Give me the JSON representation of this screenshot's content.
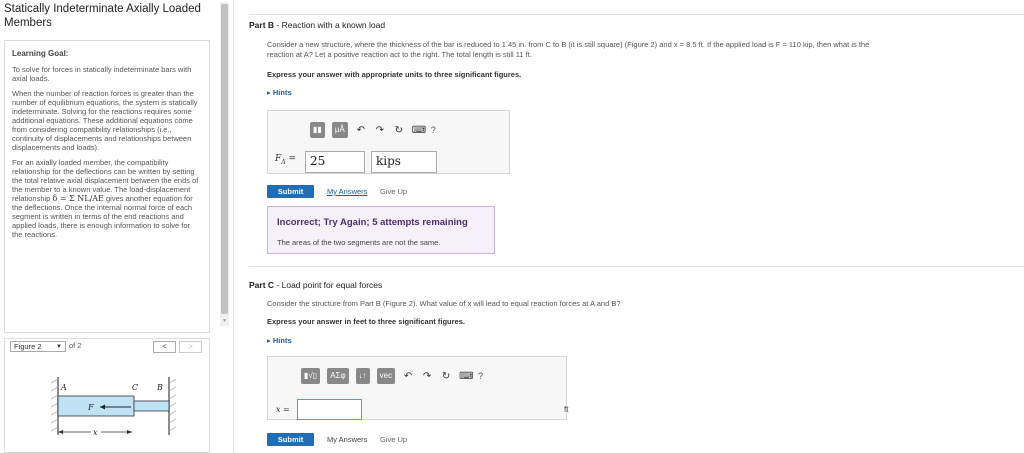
{
  "problem": {
    "title_line1": "Statically Indeterminate Axially Loaded",
    "title_line2": "Members"
  },
  "learning_goal": {
    "heading": "Learning Goal:",
    "p1": "To solve for forces in statically indeterminate bars with axial loads.",
    "p2": "When the number of reaction forces is greater than the number of equilibrium equations, the system is statically indeterminate. Solving for the reactions requires some additional equations. These additional equations come from considering compatibility relationships (i.e., continuity of displacements and relationships between displacements and loads).",
    "p3a": "For an axially loaded member, the compatibility relationship for the deflections can be written by setting the total relative axial displacement between the ends of the member to a known value. The load-displacement relationship",
    "formula": "δ = Σ NL/AE",
    "p3b": "gives another equation for the deflections. Once the internal normal force of each segment is written in terms of the end reactions and applied loads, there is enough information to solve for the reactions."
  },
  "figure": {
    "select_label": "Figure 2",
    "of_label": "of 2",
    "prev": "<",
    "next": ">",
    "labels": {
      "a": "A",
      "c": "C",
      "b": "B",
      "f": "F",
      "x": "x"
    }
  },
  "part_b": {
    "label": "Part B",
    "title": "Reaction with a known load",
    "body_line1": "Consider a new structure, where the thickness of the bar is reduced to 1.45 in. from C to B (it is still square) (Figure 2) and x = 8.5 ft. If the applied load is F = 110 kip, then what is the",
    "body_line2": "reaction at A? Let a positive reaction act to the right. The total length is still 11 ft.",
    "instruction": "Express your answer with appropriate units to three significant figures.",
    "hints": "Hints",
    "toolbar_btn2": "μÅ",
    "answer_label": "F",
    "answer_sub": "A",
    "equals": "=",
    "answer_value": "25",
    "answer_unit": "kips",
    "submit": "Submit",
    "my_answers": "My Answers",
    "give_up": "Give Up",
    "feedback_head": "Incorrect; Try Again; 5 attempts remaining",
    "feedback_msg": "The areas of the two segments are not the same."
  },
  "part_c": {
    "label": "Part C",
    "title": "Load point for equal forces",
    "body": "Consider the structure from Part B (Figure 2). What value of x will lead to equal reaction forces at A and B?",
    "instruction": "Express your answer in feet to three significant figures.",
    "hints": "Hints",
    "toolbar_btn2": "ΑΣφ",
    "toolbar_btn3": "vec",
    "answer_label": "x =",
    "answer_value": "",
    "answer_unit": "ft",
    "submit": "Submit",
    "my_answers": "My Answers",
    "give_up": "Give Up"
  }
}
